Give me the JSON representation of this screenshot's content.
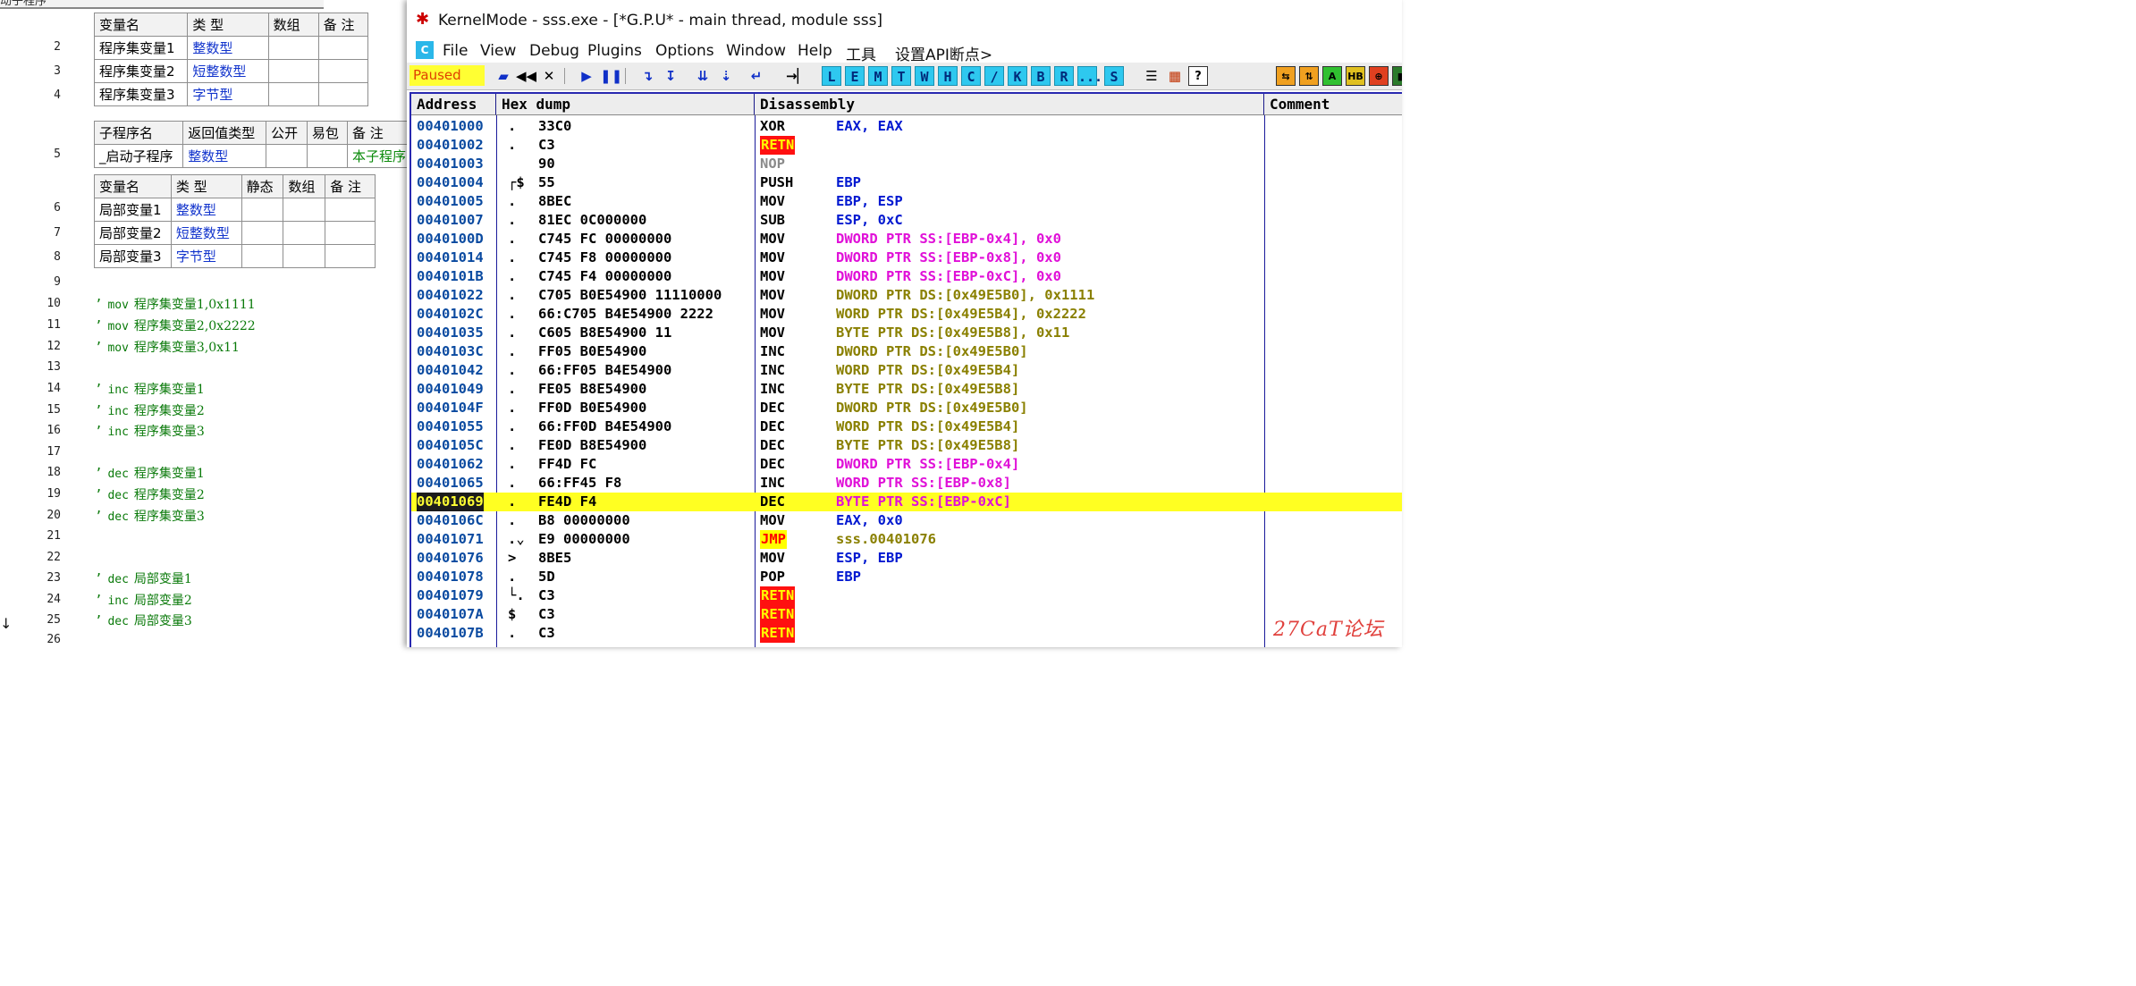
{
  "editor": {
    "top_fragment": "动子程序",
    "line_numbers": [
      "2",
      "3",
      "4",
      "5",
      "6",
      "7",
      "8",
      "9",
      "10",
      "11",
      "12",
      "13",
      "14",
      "15",
      "16",
      "17",
      "18",
      "19",
      "20",
      "21",
      "22",
      "23",
      "24",
      "25",
      "26"
    ],
    "assembly_var_table": {
      "headers": [
        "变量名",
        "类 型",
        "数组",
        "备 注"
      ],
      "rows": [
        {
          "name": "程序集变量1",
          "type": "整数型"
        },
        {
          "name": "程序集变量2",
          "type": "短整数型"
        },
        {
          "name": "程序集变量3",
          "type": "字节型"
        }
      ]
    },
    "sub_table": {
      "headers": [
        "子程序名",
        "返回值类型",
        "公开",
        "易包",
        "备 注"
      ],
      "row": {
        "name": "_启动子程序",
        "type": "整数型",
        "note": "本子程序"
      }
    },
    "local_var_table": {
      "headers": [
        "变量名",
        "类 型",
        "静态",
        "数组",
        "备 注"
      ],
      "rows": [
        {
          "name": "局部变量1",
          "type": "整数型"
        },
        {
          "name": "局部变量2",
          "type": "短整数型"
        },
        {
          "name": "局部变量3",
          "type": "字节型"
        }
      ]
    },
    "comments": [
      {
        "line": "10",
        "op": "mov",
        "text": "程序集变量1,0x1111"
      },
      {
        "line": "11",
        "op": "mov",
        "text": "程序集变量2,0x2222"
      },
      {
        "line": "12",
        "op": "mov",
        "text": "程序集变量3,0x11"
      },
      {
        "line": "14",
        "op": "inc",
        "text": "程序集变量1"
      },
      {
        "line": "15",
        "op": "inc",
        "text": "程序集变量2"
      },
      {
        "line": "16",
        "op": "inc",
        "text": "程序集变量3"
      },
      {
        "line": "18",
        "op": "dec",
        "text": "程序集变量1"
      },
      {
        "line": "19",
        "op": "dec",
        "text": "程序集变量2"
      },
      {
        "line": "20",
        "op": "dec",
        "text": "程序集变量3"
      },
      {
        "line": "23",
        "op": "dec",
        "text": "局部变量1"
      },
      {
        "line": "24",
        "op": "inc",
        "text": "局部变量2"
      },
      {
        "line": "25",
        "op": "dec",
        "text": "局部变量3"
      }
    ],
    "current_line_arrow": "↓"
  },
  "debugger": {
    "window_title": "KernelMode - sss.exe - [*G.P.U* - main thread, module sss]",
    "menu": [
      "File",
      "View",
      "Debug",
      "Plugins",
      "Options",
      "Window",
      "Help",
      "工具",
      "设置API断点>"
    ],
    "status": "Paused",
    "toolbar_letters": [
      "L",
      "E",
      "M",
      "T",
      "W",
      "H",
      "C",
      "/",
      "K",
      "B",
      "R",
      "...",
      "S"
    ],
    "columns": [
      "Address",
      "Hex dump",
      "Disassembly",
      "Comment"
    ],
    "highlight_color": "#ffff22",
    "rows": [
      {
        "addr": "00401000",
        "mark": ".",
        "hex": "33C0",
        "mn": "XOR",
        "ops": "EAX, EAX",
        "style": "blue"
      },
      {
        "addr": "00401002",
        "mark": ".",
        "hex": "C3",
        "mn": "RETN",
        "ops": "",
        "style": "retn"
      },
      {
        "addr": "00401003",
        "mark": "",
        "hex": "90",
        "mn": "NOP",
        "ops": "",
        "style": "nop"
      },
      {
        "addr": "00401004",
        "mark": "┌$",
        "hex": "55",
        "mn": "PUSH",
        "ops": "EBP",
        "style": "blue"
      },
      {
        "addr": "00401005",
        "mark": ".",
        "hex": "8BEC",
        "mn": "MOV",
        "ops": "EBP, ESP",
        "style": "blue"
      },
      {
        "addr": "00401007",
        "mark": ".",
        "hex": "81EC 0C000000",
        "mn": "SUB",
        "ops": "ESP, 0xC",
        "style": "blue"
      },
      {
        "addr": "0040100D",
        "mark": ".",
        "hex": "C745 FC 00000000",
        "mn": "MOV",
        "ops": "DWORD PTR SS:[EBP-0x4], 0x0",
        "style": "mag"
      },
      {
        "addr": "00401014",
        "mark": ".",
        "hex": "C745 F8 00000000",
        "mn": "MOV",
        "ops": "DWORD PTR SS:[EBP-0x8], 0x0",
        "style": "mag"
      },
      {
        "addr": "0040101B",
        "mark": ".",
        "hex": "C745 F4 00000000",
        "mn": "MOV",
        "ops": "DWORD PTR SS:[EBP-0xC], 0x0",
        "style": "mag"
      },
      {
        "addr": "00401022",
        "mark": ".",
        "hex": "C705 B0E54900 11110000",
        "mn": "MOV",
        "ops": "DWORD PTR DS:[0x49E5B0], 0x1111",
        "style": "olive"
      },
      {
        "addr": "0040102C",
        "mark": ".",
        "hex": "66:C705 B4E54900 2222",
        "mn": "MOV",
        "ops": "WORD PTR DS:[0x49E5B4], 0x2222",
        "style": "olive"
      },
      {
        "addr": "00401035",
        "mark": ".",
        "hex": "C605 B8E54900 11",
        "mn": "MOV",
        "ops": "BYTE PTR DS:[0x49E5B8], 0x11",
        "style": "olive"
      },
      {
        "addr": "0040103C",
        "mark": ".",
        "hex": "FF05 B0E54900",
        "mn": "INC",
        "ops": "DWORD PTR DS:[0x49E5B0]",
        "style": "olive"
      },
      {
        "addr": "00401042",
        "mark": ".",
        "hex": "66:FF05 B4E54900",
        "mn": "INC",
        "ops": "WORD PTR DS:[0x49E5B4]",
        "style": "olive"
      },
      {
        "addr": "00401049",
        "mark": ".",
        "hex": "FE05 B8E54900",
        "mn": "INC",
        "ops": "BYTE PTR DS:[0x49E5B8]",
        "style": "olive"
      },
      {
        "addr": "0040104F",
        "mark": ".",
        "hex": "FF0D B0E54900",
        "mn": "DEC",
        "ops": "DWORD PTR DS:[0x49E5B0]",
        "style": "olive"
      },
      {
        "addr": "00401055",
        "mark": ".",
        "hex": "66:FF0D B4E54900",
        "mn": "DEC",
        "ops": "WORD PTR DS:[0x49E5B4]",
        "style": "olive"
      },
      {
        "addr": "0040105C",
        "mark": ".",
        "hex": "FE0D B8E54900",
        "mn": "DEC",
        "ops": "BYTE PTR DS:[0x49E5B8]",
        "style": "olive"
      },
      {
        "addr": "00401062",
        "mark": ".",
        "hex": "FF4D FC",
        "mn": "DEC",
        "ops": "DWORD PTR SS:[EBP-0x4]",
        "style": "mag"
      },
      {
        "addr": "00401065",
        "mark": ".",
        "hex": "66:FF45 F8",
        "mn": "INC",
        "ops": "WORD PTR SS:[EBP-0x8]",
        "style": "mag"
      },
      {
        "addr": "00401069",
        "mark": ".",
        "hex": "FE4D F4",
        "mn": "DEC",
        "ops": "BYTE PTR SS:[EBP-0xC]",
        "style": "mag",
        "highlight": true
      },
      {
        "addr": "0040106C",
        "mark": ".",
        "hex": "B8 00000000",
        "mn": "MOV",
        "ops": "EAX, 0x0",
        "style": "blue"
      },
      {
        "addr": "00401071",
        "mark": ".⌄",
        "hex": "E9 00000000",
        "mn": "JMP",
        "ops": "sss.00401076",
        "style": "jmp"
      },
      {
        "addr": "00401076",
        "mark": ">",
        "hex": "8BE5",
        "mn": "MOV",
        "ops": "ESP, EBP",
        "style": "blue"
      },
      {
        "addr": "00401078",
        "mark": ".",
        "hex": "5D",
        "mn": "POP",
        "ops": "EBP",
        "style": "blue"
      },
      {
        "addr": "00401079",
        "mark": "└.",
        "hex": "C3",
        "mn": "RETN",
        "ops": "",
        "style": "retn"
      },
      {
        "addr": "0040107A",
        "mark": "$",
        "hex": "C3",
        "mn": "RETN",
        "ops": "",
        "style": "retn"
      },
      {
        "addr": "0040107B",
        "mark": ".",
        "hex": "C3",
        "mn": "RETN",
        "ops": "",
        "style": "retn"
      }
    ]
  },
  "watermark": "27CaT论坛"
}
